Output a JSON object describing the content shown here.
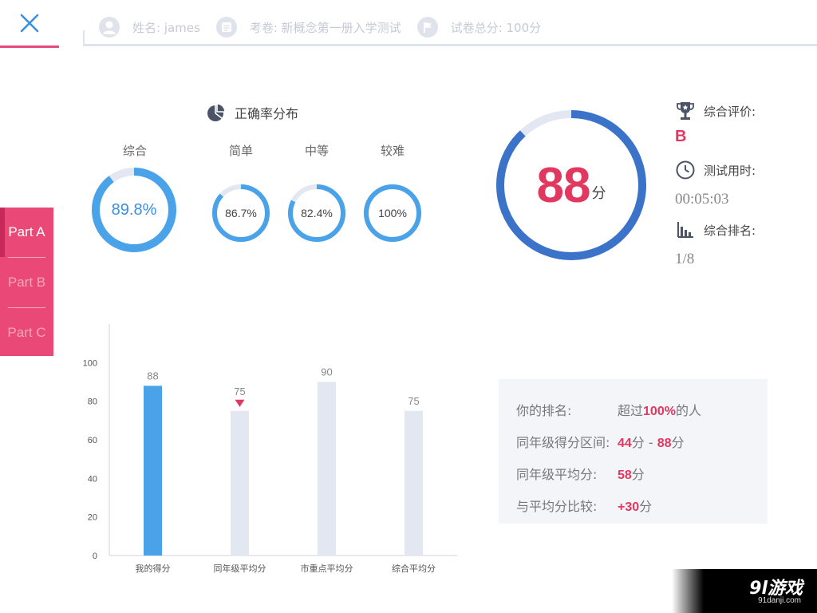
{
  "header": {
    "name_text": "姓名: james",
    "paper_text": "考卷: 新概念第一册入学测试",
    "total_text": "试卷总分: 100分"
  },
  "tabs": [
    {
      "label": "Part A",
      "active": true
    },
    {
      "label": "Part B",
      "active": false
    },
    {
      "label": "Part C",
      "active": false
    }
  ],
  "accuracy": {
    "title": "正确率分布",
    "items": [
      {
        "label": "综合",
        "value": 89.8,
        "text": "89.8%"
      },
      {
        "label": "简单",
        "value": 86.7,
        "text": "86.7%"
      },
      {
        "label": "中等",
        "value": 82.4,
        "text": "82.4%"
      },
      {
        "label": "较难",
        "value": 100,
        "text": "100%"
      }
    ]
  },
  "score": {
    "value": 88,
    "value_text": "88",
    "unit": "分",
    "fraction": 0.88
  },
  "stats": {
    "grade_label": "综合评价:",
    "grade_value": "B",
    "time_label": "测试用时:",
    "time_value": "00:05:03",
    "rank_label": "综合排名:",
    "rank_value": "1/8"
  },
  "ranking": {
    "rows": [
      {
        "label": "你的排名:",
        "parts": [
          {
            "t": "超过",
            "hl": false
          },
          {
            "t": "100%",
            "hl": true
          },
          {
            "t": "的人",
            "hl": false
          }
        ]
      },
      {
        "label": "同年级得分区间:",
        "parts": [
          {
            "t": "44",
            "hl": true
          },
          {
            "t": "分 - ",
            "hl": false
          },
          {
            "t": "88",
            "hl": true
          },
          {
            "t": "分",
            "hl": false
          }
        ]
      },
      {
        "label": "同年级平均分:",
        "parts": [
          {
            "t": "58",
            "hl": true
          },
          {
            "t": "分",
            "hl": false
          }
        ]
      },
      {
        "label": "与平均分比较:",
        "parts": [
          {
            "t": "+30",
            "hl": true
          },
          {
            "t": "分",
            "hl": false
          }
        ]
      }
    ]
  },
  "colors": {
    "accent_pink": "#e2375f",
    "ring_blue": "#4aa3e8",
    "score_blue": "#3b73c9",
    "track": "#e3e7f1",
    "bar_highlight": "#4aa3e8",
    "bar_normal": "#e3e7f1"
  },
  "chart_data": {
    "type": "bar",
    "categories": [
      "我的得分",
      "同年级平均分",
      "市重点平均分",
      "综合平均分"
    ],
    "values": [
      88,
      75,
      90,
      75
    ],
    "yticks": [
      0,
      20,
      40,
      60,
      80,
      100
    ],
    "ylim": [
      0,
      120
    ],
    "highlight_index": 0,
    "marker_index": 1
  },
  "watermark": {
    "logo": "9l游戏",
    "url": "91danji.com"
  }
}
